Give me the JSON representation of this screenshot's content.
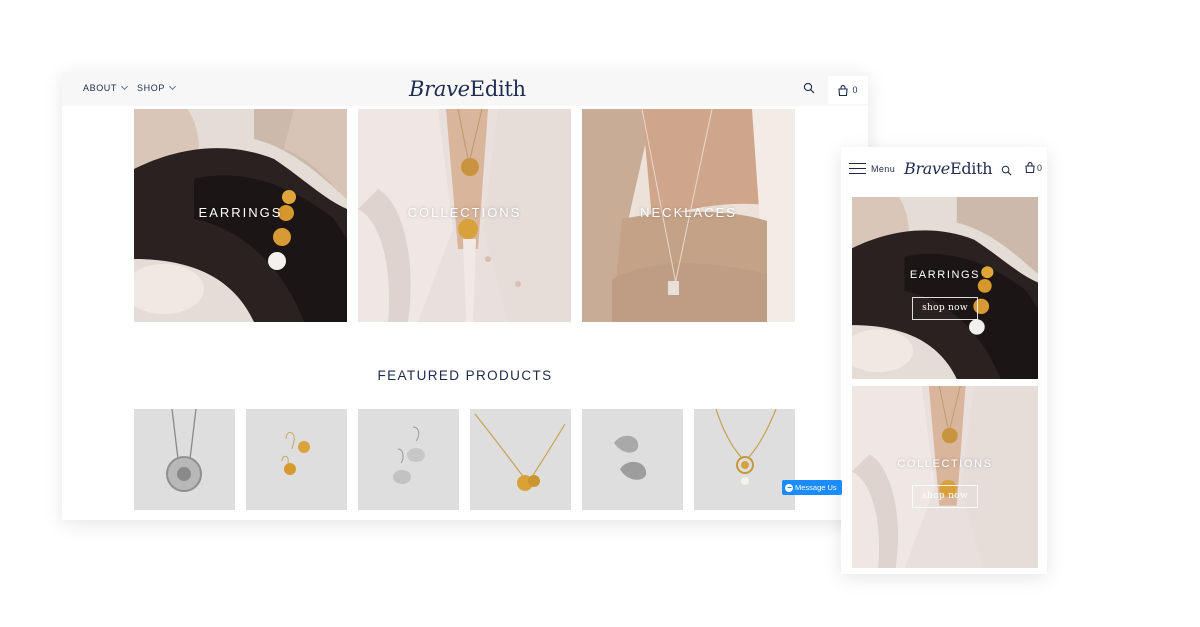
{
  "brand": {
    "word1": "Brave",
    "word2": "Edith"
  },
  "desktop": {
    "nav": [
      {
        "label": "ABOUT"
      },
      {
        "label": "SHOP"
      }
    ],
    "cart_count": "0",
    "collections": [
      {
        "label": "EARRINGS"
      },
      {
        "label": "COLLECTIONS"
      },
      {
        "label": "NECKLACES"
      }
    ],
    "featured_title": "FEATURED PRODUCTS",
    "products": [
      {
        "name": "coin-necklace"
      },
      {
        "name": "gold-flower-earrings"
      },
      {
        "name": "silver-ginkgo-earrings"
      },
      {
        "name": "gold-flower-necklace"
      },
      {
        "name": "silver-petal-studs"
      },
      {
        "name": "gold-pendant-pearl-necklace"
      }
    ],
    "messenger_label": "Message Us"
  },
  "mobile": {
    "menu_label": "Menu",
    "cart_count": "0",
    "tiles": [
      {
        "label": "EARRINGS",
        "button": "shop now"
      },
      {
        "label": "COLLECTIONS",
        "button": "shop now"
      }
    ]
  },
  "colors": {
    "navy": "#1e2a4a",
    "messenger_blue": "#1a8cff",
    "product_bg": "#dedede"
  }
}
